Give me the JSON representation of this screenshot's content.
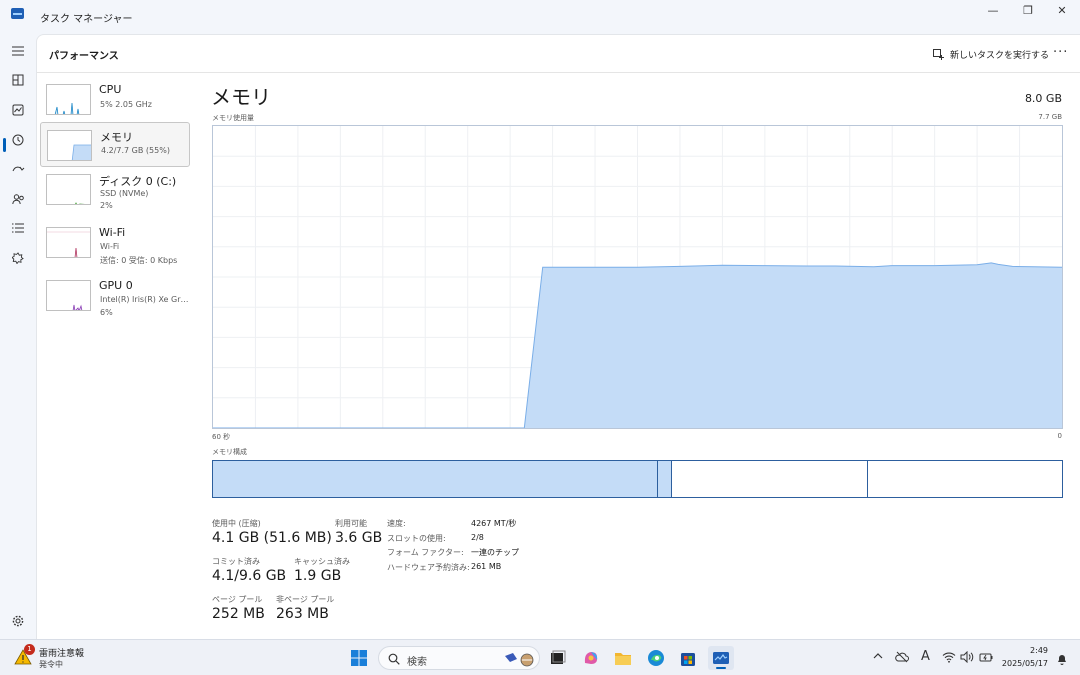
{
  "window": {
    "title": "タスク マネージャー",
    "minimize_label": "—",
    "restore_label": "❐",
    "close_label": "✕"
  },
  "header": {
    "page_title": "パフォーマンス",
    "run_new_task": "新しいタスクを実行する",
    "more_label": "···"
  },
  "devices": [
    {
      "name": "CPU",
      "sub1": "5%  2.05 GHz",
      "sub2": ""
    },
    {
      "name": "メモリ",
      "sub1": "4.2/7.7 GB (55%)",
      "sub2": ""
    },
    {
      "name": "ディスク 0 (C:)",
      "sub1": "SSD (NVMe)",
      "sub2": "2%"
    },
    {
      "name": "Wi-Fi",
      "sub1": "Wi-Fi",
      "sub2": "送信: 0 受信: 0 Kbps"
    },
    {
      "name": "GPU 0",
      "sub1": "Intel(R) Iris(R) Xe Grap...",
      "sub2": "6%"
    }
  ],
  "main": {
    "title": "メモリ",
    "total": "8.0 GB",
    "usage_label": "メモリ使用量",
    "usage_max": "7.7 GB",
    "axis_left": "60 秒",
    "axis_right": "0",
    "composition_label": "メモリ構成"
  },
  "chart_data": {
    "type": "area",
    "x_label_left": "60 秒",
    "x_label_right": "0",
    "ylim": [
      0,
      7.7
    ],
    "unit": "GB",
    "grid": true,
    "x": [
      60,
      38,
      36.7,
      30,
      27,
      24,
      21,
      18,
      16,
      13.3,
      12,
      9,
      6,
      5,
      4.5,
      3.5,
      2,
      0
    ],
    "values": [
      0,
      0,
      4.1,
      4.1,
      4.12,
      4.15,
      4.14,
      4.13,
      4.13,
      4.11,
      4.14,
      4.14,
      4.16,
      4.21,
      4.17,
      4.12,
      4.11,
      4.1
    ]
  },
  "composition": [
    {
      "name": "in-use",
      "fraction": 0.524,
      "filled": true
    },
    {
      "name": "modified",
      "fraction": 0.017,
      "filled": true
    },
    {
      "name": "standby",
      "fraction": 0.23,
      "filled": false
    },
    {
      "name": "free",
      "fraction": 0.229,
      "filled": false
    }
  ],
  "stats": {
    "in_use_label": "使用中 (圧縮)",
    "in_use_value": "4.1 GB (51.6 MB)",
    "available_label": "利用可能",
    "available_value": "3.6 GB",
    "committed_label": "コミット済み",
    "committed_value": "4.1/9.6 GB",
    "cached_label": "キャッシュ済み",
    "cached_value": "1.9 GB",
    "paged_label": "ページ プール",
    "paged_value": "252 MB",
    "nonpaged_label": "非ページ プール",
    "nonpaged_value": "263 MB"
  },
  "specs": [
    {
      "key": "速度:",
      "value": "4267 MT/秒"
    },
    {
      "key": "スロットの使用:",
      "value": "2/8"
    },
    {
      "key": "フォーム ファクター:",
      "value": "一連のチップ"
    },
    {
      "key": "ハードウェア予約済み:",
      "value": "261 MB"
    }
  ],
  "taskbar": {
    "weather_title": "雷雨注意報",
    "weather_sub": "発令中",
    "weather_badge": "1",
    "search_placeholder": "検索",
    "ime_label": "A",
    "time": "2:49",
    "date": "2025/05/17"
  },
  "colors": {
    "accent": "#005fb8",
    "memory_fill": "#c4dcf7",
    "memory_line": "#7aaee8",
    "composition_border": "#2d5f9e"
  }
}
